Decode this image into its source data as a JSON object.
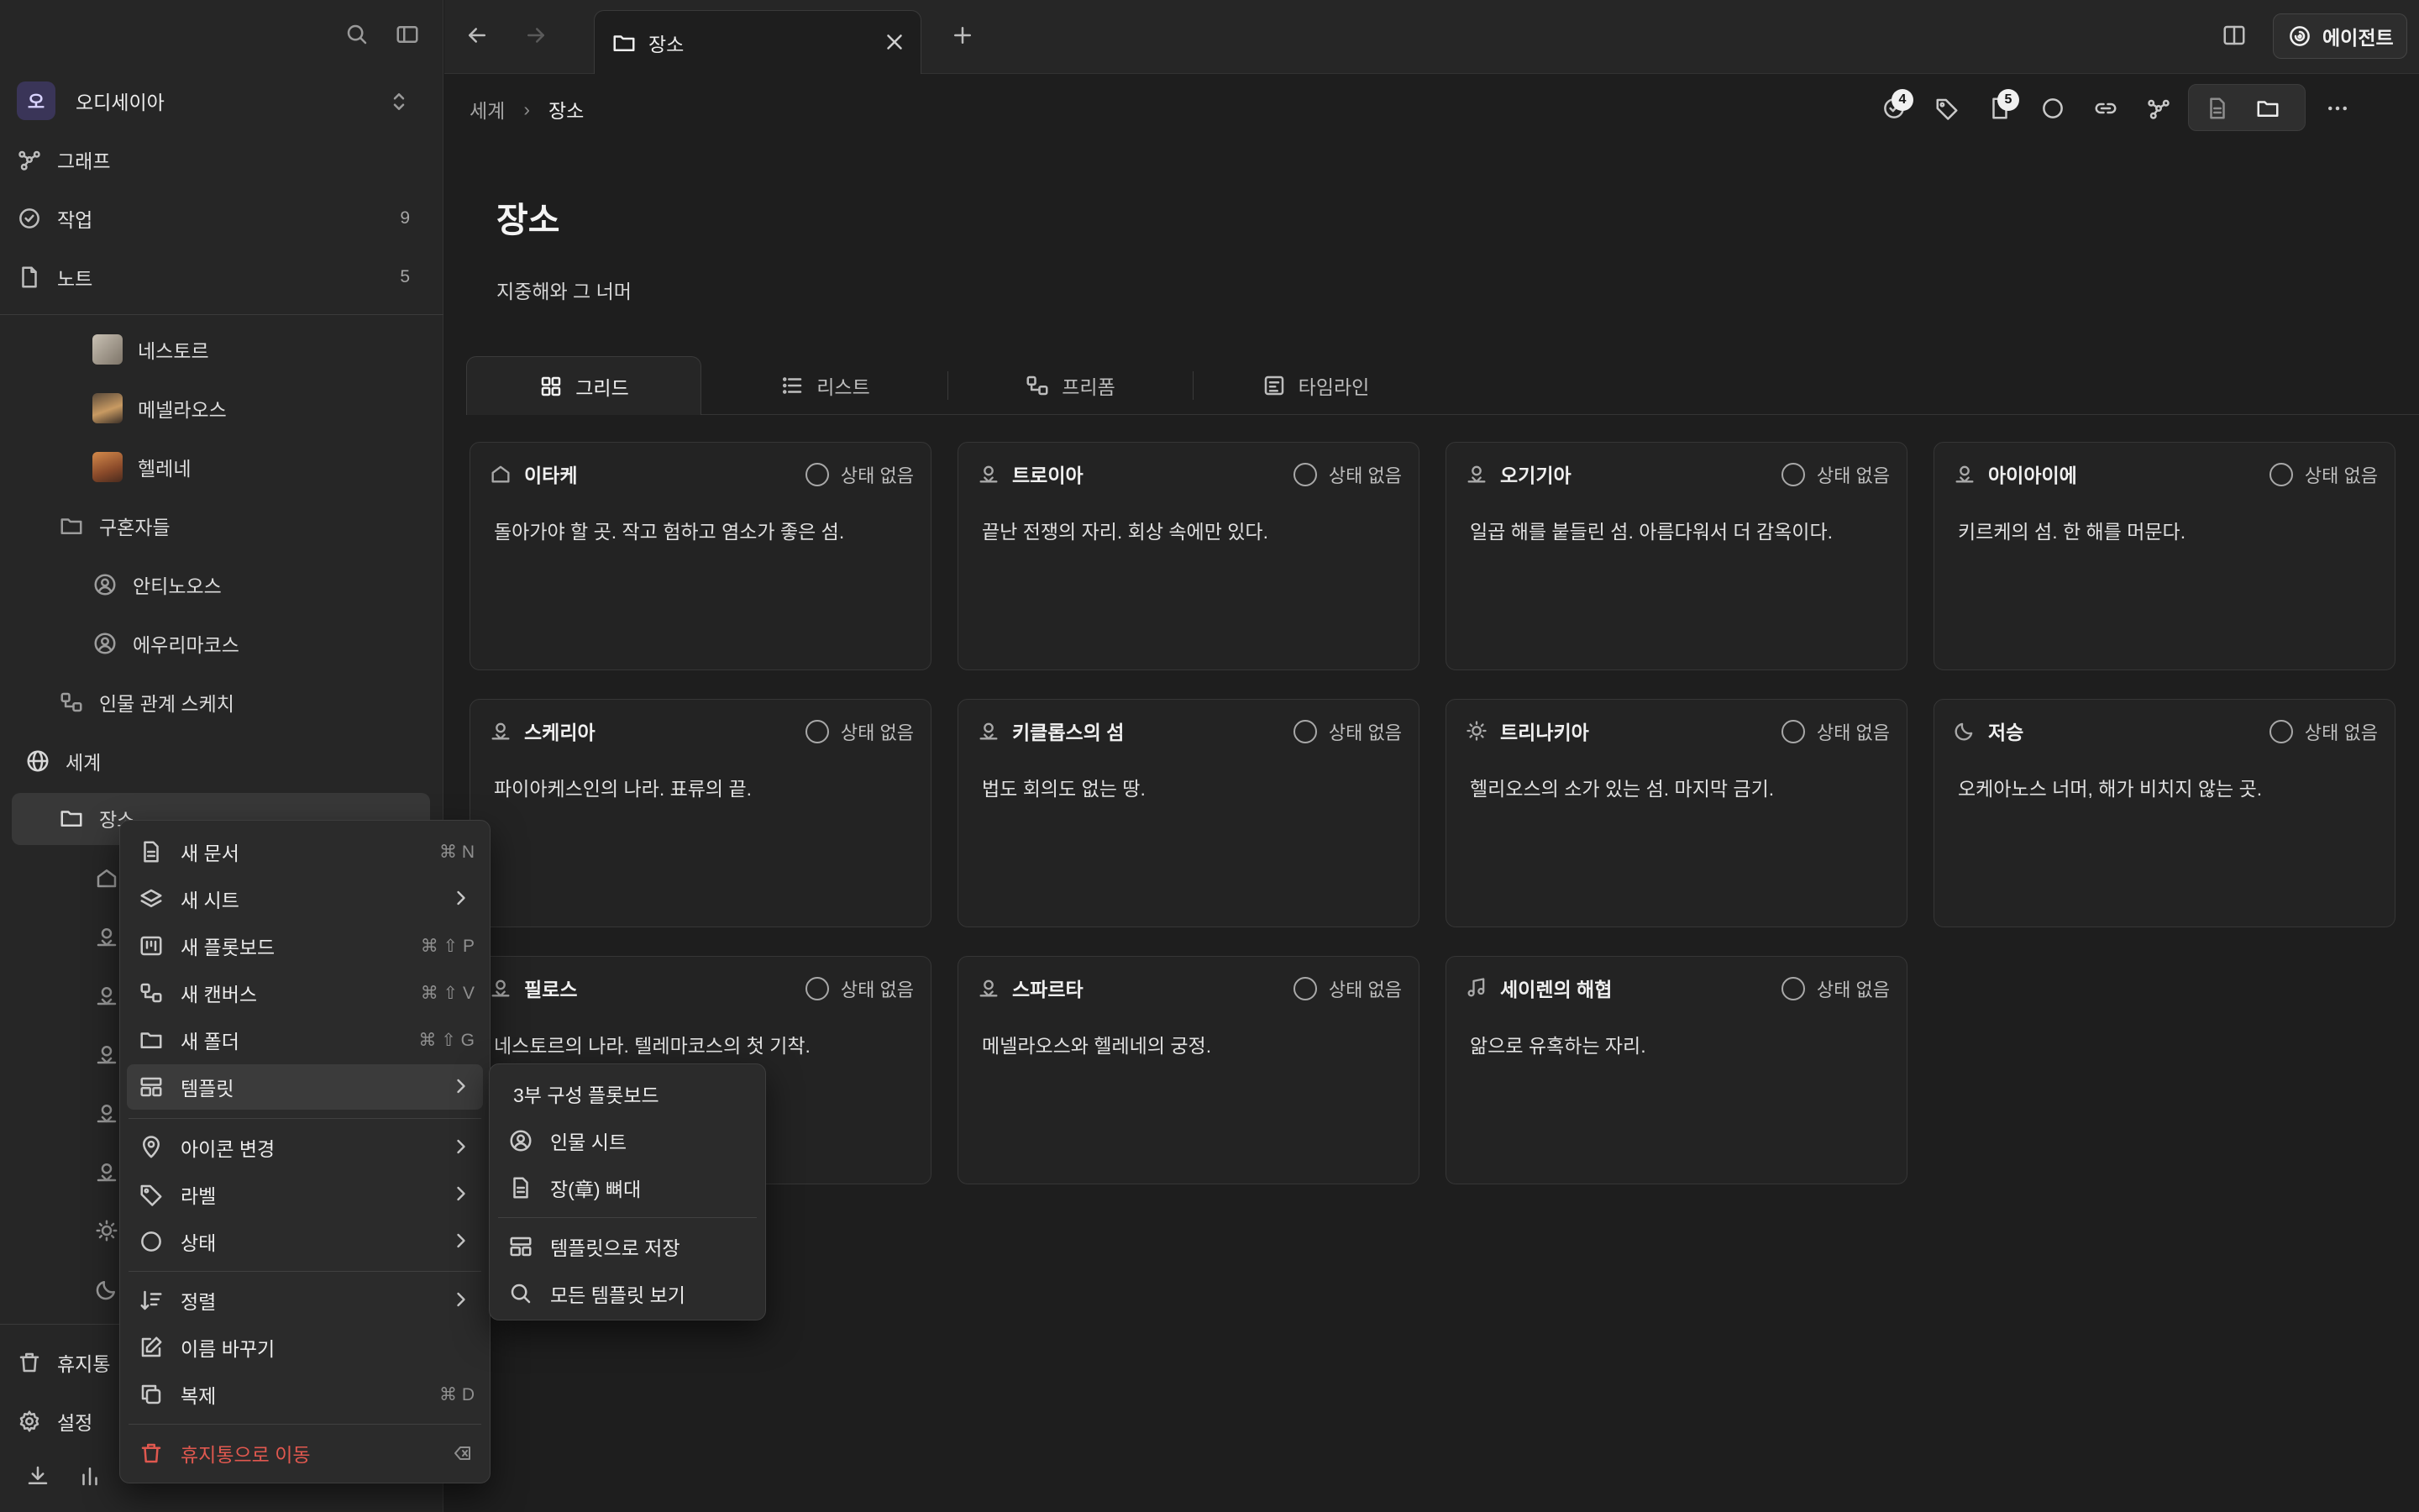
{
  "workspace": {
    "avatar": "오",
    "name": "오디세이아"
  },
  "nav": [
    {
      "label": "그래프",
      "icon": "graph-icon",
      "count": ""
    },
    {
      "label": "작업",
      "icon": "check-circle-icon",
      "count": "9"
    },
    {
      "label": "노트",
      "icon": "note-icon",
      "count": "5"
    }
  ],
  "tree": {
    "nestor": "네스토르",
    "menelaus": "메넬라오스",
    "helen": "헬레네",
    "suitors_folder": "구혼자들",
    "antinous": "안티노오스",
    "eurymachus": "에우리마코스",
    "relation_sketch": "인물 관계 스케치",
    "world": "세계",
    "places": "장소",
    "trash": "휴지통",
    "settings": "설정"
  },
  "tabbar": {
    "tab_title": "장소",
    "agent_label": "에이전트"
  },
  "breadcrumb": {
    "parent": "세계",
    "current": "장소"
  },
  "toolbar": {
    "tasks_badge": "4",
    "notes_badge": "5"
  },
  "page": {
    "title": "장소",
    "subtitle": "지중해와 그 너머"
  },
  "view_tabs": [
    {
      "label": "그리드",
      "icon": "grid-icon"
    },
    {
      "label": "리스트",
      "icon": "list-icon"
    },
    {
      "label": "프리폼",
      "icon": "freeform-icon"
    },
    {
      "label": "타임라인",
      "icon": "timeline-icon"
    }
  ],
  "cards": [
    {
      "title": "이타케",
      "icon": "home-icon",
      "status": "상태 없음",
      "desc": "돌아가야 할 곳. 작고 험하고 염소가 좋은 섬."
    },
    {
      "title": "트로이아",
      "icon": "person-pin-icon",
      "status": "상태 없음",
      "desc": "끝난 전쟁의 자리. 회상 속에만 있다."
    },
    {
      "title": "오기기아",
      "icon": "person-pin-icon",
      "status": "상태 없음",
      "desc": "일곱 해를 붙들린 섬. 아름다워서 더 감옥이다."
    },
    {
      "title": "아이아이에",
      "icon": "person-pin-icon",
      "status": "상태 없음",
      "desc": "키르케의 섬. 한 해를 머문다."
    },
    {
      "title": "스케리아",
      "icon": "person-pin-icon",
      "status": "상태 없음",
      "desc": "파이아케스인의 나라. 표류의 끝."
    },
    {
      "title": "키클롭스의 섬",
      "icon": "person-pin-icon",
      "status": "상태 없음",
      "desc": "법도 회의도 없는 땅."
    },
    {
      "title": "트리나키아",
      "icon": "sun-icon",
      "status": "상태 없음",
      "desc": "헬리오스의 소가 있는 섬. 마지막 금기."
    },
    {
      "title": "저승",
      "icon": "moon-icon",
      "status": "상태 없음",
      "desc": "오케아노스 너머, 해가 비치지 않는 곳."
    },
    {
      "title": "필로스",
      "icon": "person-pin-icon",
      "status": "상태 없음",
      "desc": "네스토르의 나라. 텔레마코스의 첫 기착."
    },
    {
      "title": "스파르타",
      "icon": "person-pin-icon",
      "status": "상태 없음",
      "desc": "메넬라오스와 헬레네의 궁정."
    },
    {
      "title": "세이렌의 해협",
      "icon": "music-icon",
      "status": "상태 없음",
      "desc": "앎으로 유혹하는 자리."
    }
  ],
  "context_menu": {
    "new_doc": "새 문서",
    "new_doc_sc": "⌘ N",
    "new_sheet": "새 시트",
    "new_plotboard": "새 플롯보드",
    "new_plotboard_sc": "⌘ ⇧ P",
    "new_canvas": "새 캔버스",
    "new_canvas_sc": "⌘ ⇧ V",
    "new_folder": "새 폴더",
    "new_folder_sc": "⌘ ⇧ G",
    "template": "템플릿",
    "change_icon": "아이콘 변경",
    "label": "라벨",
    "status": "상태",
    "sort": "정렬",
    "rename": "이름 바꾸기",
    "duplicate": "복제",
    "duplicate_sc": "⌘ D",
    "trash": "휴지통으로 이동"
  },
  "submenu": {
    "three_act": "3부 구성 플롯보드",
    "character_sheet": "인물 시트",
    "chapter_skeleton": "장(章) 뼈대",
    "save_as_template": "템플릿으로 저장",
    "view_all": "모든 템플릿 보기"
  },
  "colors": {
    "danger": "#e0584f",
    "avatar_bg": "#3a3558"
  }
}
